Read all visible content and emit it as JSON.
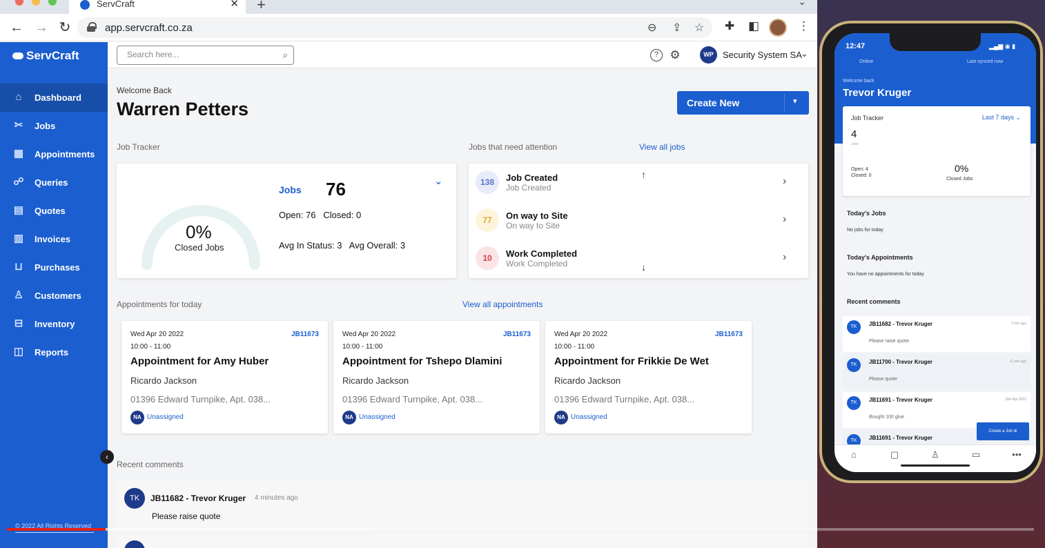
{
  "browser": {
    "tab_title": "ServCraft",
    "tab_close": "✕",
    "new_tab": "+",
    "url": "app.servcraft.co.za"
  },
  "sidebar": {
    "brand": "ServCraft",
    "collapse": "‹",
    "footer": "© 2022 All Rights Reserved",
    "items": [
      {
        "label": "Dashboard",
        "icon": "home-icon",
        "glyph": "⌂"
      },
      {
        "label": "Jobs",
        "icon": "tools-icon",
        "glyph": "✂"
      },
      {
        "label": "Appointments",
        "icon": "calendar-icon",
        "glyph": "▦"
      },
      {
        "label": "Queries",
        "icon": "handshake-icon",
        "glyph": "☍"
      },
      {
        "label": "Quotes",
        "icon": "quote-doc-icon",
        "glyph": "▤"
      },
      {
        "label": "Invoices",
        "icon": "invoice-icon",
        "glyph": "▥"
      },
      {
        "label": "Purchases",
        "icon": "cart-icon",
        "glyph": "⊔"
      },
      {
        "label": "Customers",
        "icon": "user-icon",
        "glyph": "♙"
      },
      {
        "label": "Inventory",
        "icon": "inventory-icon",
        "glyph": "⊟"
      },
      {
        "label": "Reports",
        "icon": "report-icon",
        "glyph": "◫"
      }
    ]
  },
  "header": {
    "search_placeholder": "Search here...",
    "help": "?",
    "settings": "⚙",
    "org_initials": "WP",
    "org_name": "Security System SA",
    "org_caret": "⌄"
  },
  "dashboard": {
    "welcome": "Welcome Back",
    "user_name": "Warren Petters",
    "create_new": "Create New",
    "create_caret": "▾",
    "job_tracker": {
      "label": "Job Tracker",
      "gauge_pct": "0%",
      "gauge_label": "Closed Jobs",
      "gauge_fraction": 0,
      "jobs_label": "Jobs",
      "jobs_count": "76",
      "open_closed": "Open: 76   Closed: 0",
      "averages": "Avg In Status: 3   Avg Overall: 3",
      "expand": "⌄"
    },
    "attention": {
      "label": "Jobs that need attention",
      "view_all": "View all jobs",
      "up": "↑",
      "down": "↓",
      "items": [
        {
          "count": "138",
          "title": "Job Created",
          "sub": "Job Created",
          "color": "#5b74c9",
          "bg": "#e8ecfa"
        },
        {
          "count": "77",
          "title": "On way to Site",
          "sub": "On way to Site",
          "color": "#e0a82e",
          "bg": "#fdf4dc"
        },
        {
          "count": "10",
          "title": "Work Completed",
          "sub": "Work Completed",
          "color": "#d8404f",
          "bg": "#fbe3e6"
        }
      ]
    },
    "appointments": {
      "label": "Appointments for today",
      "view_all": "View all appointments",
      "items": [
        {
          "date": "Wed Apr 20 2022",
          "time": "10:00 - 11:00",
          "job": "JB11673",
          "title": "Appointment for Amy Huber",
          "person": "Ricardo Jackson",
          "address": "01396 Edward Turnpike, Apt. 038...",
          "initials": "NA",
          "status": "Unassigned"
        },
        {
          "date": "Wed Apr 20 2022",
          "time": "10:00 - 11:00",
          "job": "JB11673",
          "title": "Appointment for Tshepo Dlamini",
          "person": "Ricardo Jackson",
          "address": "01396 Edward Turnpike, Apt. 038...",
          "initials": "NA",
          "status": "Unassigned"
        },
        {
          "date": "Wed Apr 20 2022",
          "time": "10:00 - 11:00",
          "job": "JB11673",
          "title": "Appointment for Frikkie De Wet",
          "person": "Ricardo Jackson",
          "address": "01396 Edward Turnpike, Apt. 038...",
          "initials": "NA",
          "status": "Unassigned"
        }
      ]
    },
    "comments": {
      "label": "Recent comments",
      "items": [
        {
          "initials": "TK",
          "head": "JB11682 - Trevor Kruger",
          "time": "4 minutes ago",
          "body": "Please raise quote"
        }
      ]
    }
  },
  "video": {
    "played_fraction": 0.096,
    "loaded_fraction": 0.358
  },
  "phone": {
    "time": "12:47",
    "status_icons": "▂▄▆ ◉ ▮",
    "online": "Online",
    "synced": "Last synced now",
    "welcome": "Welcome back",
    "name": "Trevor Kruger",
    "tracker_label": "Job Tracker",
    "range": "Last 7 days ⌄",
    "jobs_count": "4",
    "jobs_small": "Jobs",
    "open": "Open: 4",
    "closed": "Closed: 0",
    "pct": "0%",
    "closed_jobs": "Closed Jobs",
    "todays_jobs": "Today's Jobs",
    "no_jobs": "No jobs for today",
    "todays_appts": "Today's Appointments",
    "no_appts": "You have no appointments for today",
    "recent_comments": "Recent comments",
    "comments": [
      {
        "initials": "TK",
        "head": "JB11682 - Trevor Kruger",
        "time": "3 min ago",
        "body": "Please raise quote"
      },
      {
        "initials": "TK",
        "head": "JB11700 - Trevor Kruger",
        "time": "11 min ago",
        "body": "Please quote"
      },
      {
        "initials": "TK",
        "head": "JB11691 - Trevor Kruger",
        "time": "19th Apr 2022",
        "body": "Bought 100 glue"
      },
      {
        "initials": "TK",
        "head": "JB11691 - Trevor Kruger",
        "time": "",
        "body": ""
      }
    ],
    "create_job": "Create a Job  ⊕",
    "tabs": [
      {
        "icon": "home-icon",
        "glyph": "⌂"
      },
      {
        "icon": "jobs-icon",
        "glyph": "▢"
      },
      {
        "icon": "customers-icon",
        "glyph": "♙"
      },
      {
        "icon": "clipboard-icon",
        "glyph": "▭"
      },
      {
        "icon": "more-icon",
        "glyph": "•••"
      }
    ]
  }
}
